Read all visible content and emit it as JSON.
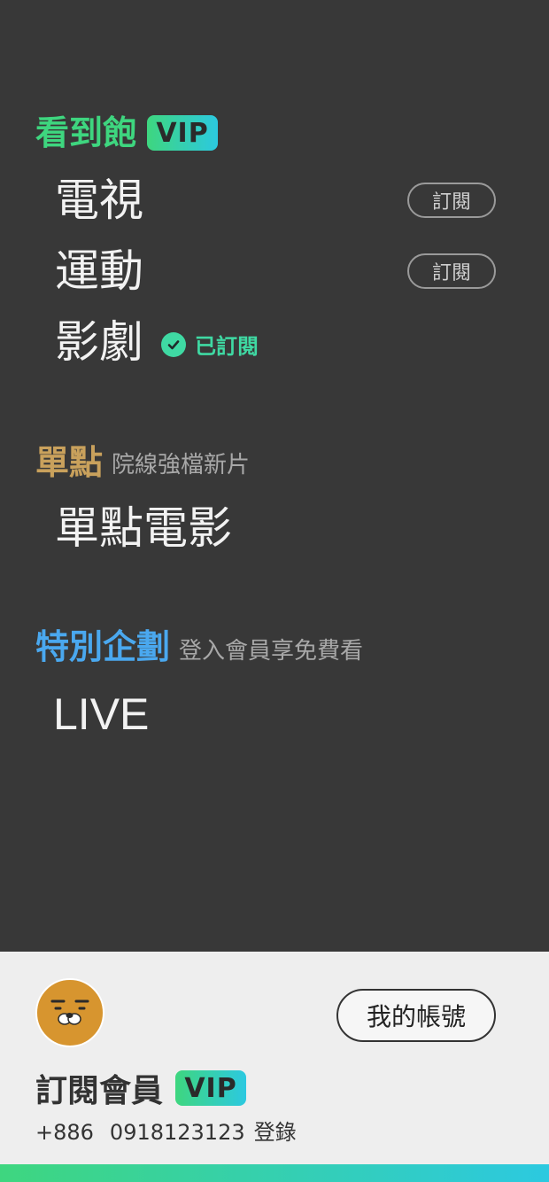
{
  "vip_section": {
    "title": "看到飽",
    "badge": "VIP",
    "items": [
      {
        "label": "電視",
        "action": "訂閱"
      },
      {
        "label": "運動",
        "action": "訂閱"
      },
      {
        "label": "影劇",
        "status": "已訂閱"
      }
    ]
  },
  "single_section": {
    "title": "單點",
    "subtitle": "院線強檔新片",
    "items": [
      {
        "label": "單點電影"
      }
    ]
  },
  "special_section": {
    "title": "特別企劃",
    "subtitle": "登入會員享免費看",
    "items": [
      {
        "label": "LIVE"
      }
    ]
  },
  "profile": {
    "account_button": "我的帳號",
    "member_label": "訂閱會員",
    "member_badge": "VIP",
    "country_code": "+886",
    "phone": "0918123123",
    "login_text": "登錄"
  },
  "colors": {
    "vip_green": "#3ed67f",
    "single_gold": "#c9a15c",
    "special_blue": "#4aa8ef",
    "subscribed_teal": "#3fd9a3",
    "accent_gradient_end": "#2cc9e0"
  },
  "icons": {
    "check": "check-circle-icon",
    "avatar": "character-avatar"
  }
}
